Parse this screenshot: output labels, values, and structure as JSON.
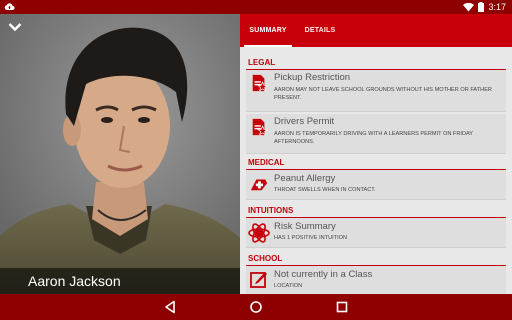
{
  "status_bar": {
    "time": "3:17",
    "icons": [
      "cloud-upload-icon",
      "wifi-icon",
      "battery-icon"
    ]
  },
  "profile": {
    "name": "Aaron Jackson",
    "collapse_icon": "chevron-down-icon"
  },
  "tabs": [
    {
      "label": "SUMMARY",
      "selected": true
    },
    {
      "label": "DETAILS",
      "selected": false
    }
  ],
  "sections": {
    "legal": {
      "header": "LEGAL",
      "items": [
        {
          "title": "Pickup Restriction",
          "subtitle": "AARON MAY NOT LEAVE SCHOOL GROUNDS WITHOUT HIS MOTHER OR FATHER PRESENT.",
          "icon": "legal-document-icon"
        },
        {
          "title": "Drivers Permit",
          "subtitle": "AARON IS TEMPORARILY DRIVING WITH A LEARNERS PERMIT ON FRIDAY AFTERNOONS.",
          "icon": "legal-document-icon"
        }
      ]
    },
    "medical": {
      "header": "MEDICAL",
      "items": [
        {
          "title": "Peanut Allergy",
          "subtitle": "THROAT SWELLS WHEN IN CONTACT.",
          "icon": "medical-icon"
        }
      ]
    },
    "intuitions": {
      "header": "INTUITIONS",
      "items": [
        {
          "title": "Risk Summary",
          "subtitle": "HAS 1 POSITIVE INTUITION",
          "icon": "risk-atom-icon"
        }
      ]
    },
    "school": {
      "header": "SCHOOL",
      "items": [
        {
          "title": "Not currently in a Class",
          "subtitle": "LOCATION",
          "icon": "edit-note-icon"
        }
      ]
    }
  },
  "nav_bar": {
    "buttons": [
      "back-icon",
      "home-icon",
      "recents-icon"
    ]
  },
  "colors": {
    "accent": "#c8000a",
    "status_bar": "#8e0000",
    "section_header": "#c0000a",
    "panel_bg": "#e8e8e8"
  }
}
